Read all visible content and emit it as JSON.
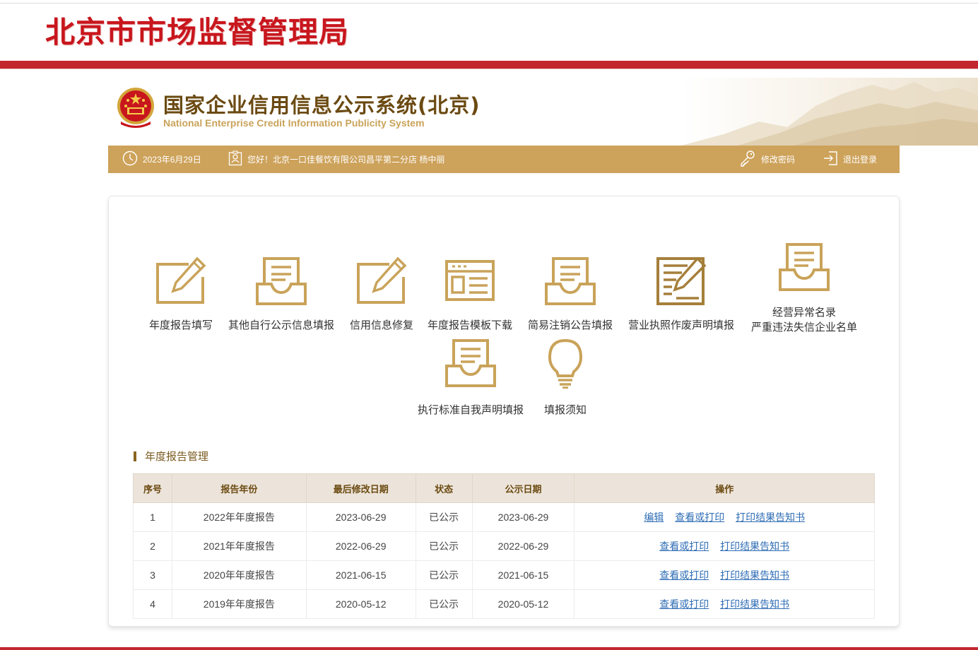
{
  "header": {
    "agency_title": "北京市市场监督管理局",
    "system_title_cn": "国家企业信用信息公示系统(北京)",
    "system_title_en": "National Enterprise Credit Information Publicity System"
  },
  "userbar": {
    "date": "2023年6月29日",
    "greeting": "您好！北京一口佳餐饮有限公司昌平第二分店  杨中丽",
    "change_password": "修改密码",
    "logout": "退出登录"
  },
  "functions": [
    {
      "label": "年度报告填写",
      "icon": "edit-pencil-icon"
    },
    {
      "label": "其他自行公示信息填报",
      "icon": "document-tray-icon"
    },
    {
      "label": "信用信息修复",
      "icon": "edit-pencil-icon"
    },
    {
      "label": "年度报告模板下载",
      "icon": "template-layout-icon"
    },
    {
      "label": "简易注销公告填报",
      "icon": "document-tray-icon"
    },
    {
      "label": "营业执照作废声明填报",
      "icon": "document-edit-icon"
    },
    {
      "label": "经营异常名录",
      "label2": "严重违法失信企业名单",
      "icon": "document-tray-icon"
    },
    {
      "label": "执行标准自我声明填报",
      "icon": "document-tray-icon"
    },
    {
      "label": "填报须知",
      "icon": "lightbulb-icon"
    }
  ],
  "section_title": "年度报告管理",
  "table": {
    "headers": [
      "序号",
      "报告年份",
      "最后修改日期",
      "状态",
      "公示日期",
      "操作"
    ],
    "rows": [
      {
        "no": "1",
        "year": "2022年年度报告",
        "modified": "2023-06-29",
        "status": "已公示",
        "published": "2023-06-29",
        "actions": [
          "编辑",
          "查看或打印",
          "打印结果告知书"
        ]
      },
      {
        "no": "2",
        "year": "2021年年度报告",
        "modified": "2022-06-29",
        "status": "已公示",
        "published": "2022-06-29",
        "actions": [
          "查看或打印",
          "打印结果告知书"
        ]
      },
      {
        "no": "3",
        "year": "2020年年度报告",
        "modified": "2021-06-15",
        "status": "已公示",
        "published": "2021-06-15",
        "actions": [
          "查看或打印",
          "打印结果告知书"
        ]
      },
      {
        "no": "4",
        "year": "2019年年度报告",
        "modified": "2020-05-12",
        "status": "已公示",
        "published": "2020-05-12",
        "actions": [
          "查看或打印",
          "打印结果告知书"
        ]
      }
    ]
  },
  "colors": {
    "brand_red": "#c1272d",
    "gold": "#cda25a",
    "icon_gold": "#c9a35a",
    "link_blue": "#2f6db5"
  }
}
